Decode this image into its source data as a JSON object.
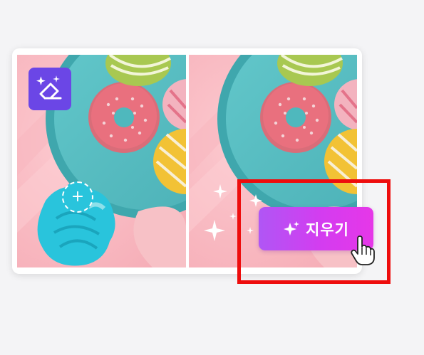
{
  "editor": {
    "tool_icon": "magic-eraser-icon",
    "add_icon": "plus-icon",
    "erase_button": {
      "label": "지우기",
      "icon": "sparkle-icon"
    },
    "cursor_icon": "hand-pointer-icon",
    "colors": {
      "background": "#fbc0c6",
      "tool_badge": "#6b46e6",
      "selection_mask": "#29c4dc",
      "button_gradient_start": "#b056f5",
      "button_gradient_end": "#e637e8",
      "highlight_outline": "#ee0d0d"
    }
  }
}
